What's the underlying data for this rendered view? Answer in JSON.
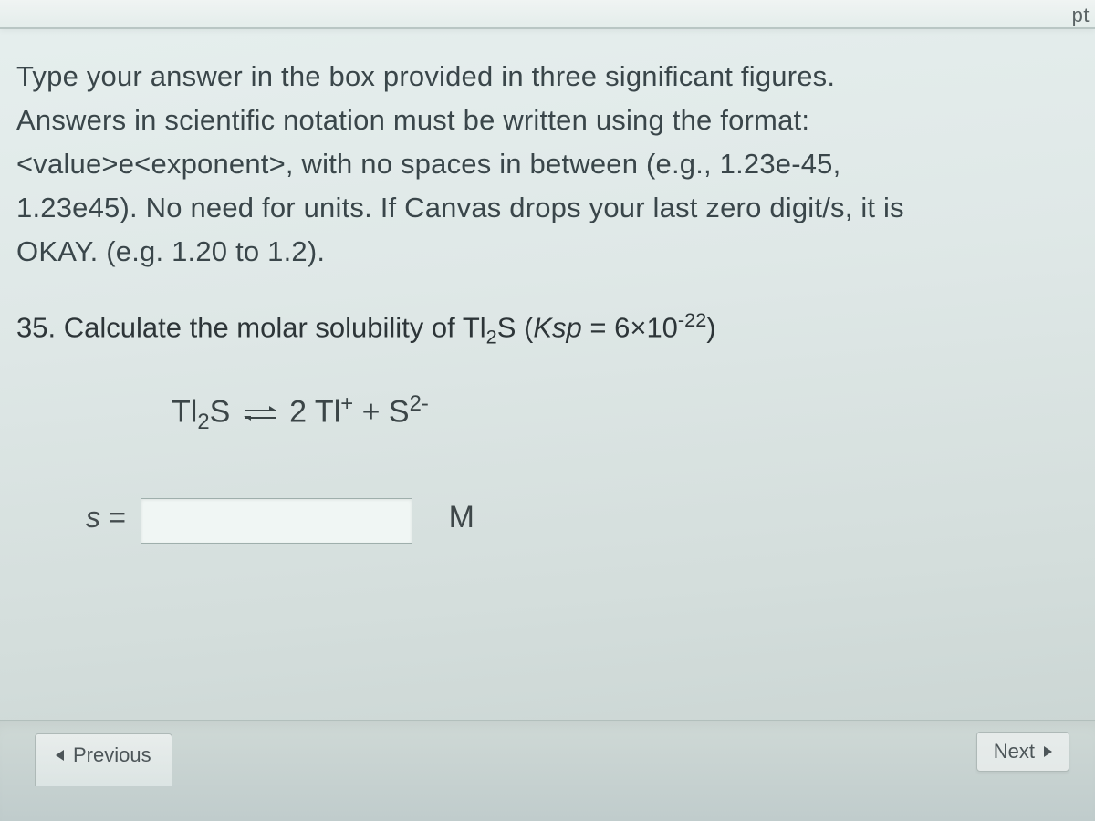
{
  "header": {
    "points_fragment": "pt"
  },
  "instructions": {
    "line1": "Type your answer in the box provided in three significant figures.",
    "line2": "Answers in scientific notation must be written using the format:",
    "line3a": "<value>e<exponent>, with no spaces in between (e.g., 1.23e-45,",
    "line3b": "1.23e45). No need for units.  If Canvas drops your last zero digit/s, it is",
    "line3c": "OKAY. (e.g. 1.20 to 1.2)."
  },
  "question": {
    "number": "35.",
    "prompt_pre": "Calculate the molar solubility of Tl",
    "prompt_sub1": "2",
    "prompt_mid": "S (",
    "ksp_label": "Ksp",
    "eq": " = 6×10",
    "exp": "-22",
    "close": ")"
  },
  "equation": {
    "lhs_a": "Tl",
    "lhs_sub": "2",
    "lhs_b": "S",
    "rhs_coef": "2",
    "rhs_a": " Tl",
    "rhs_a_sup": "+",
    "plus": " + ",
    "rhs_b": "S",
    "rhs_b_sup": "2-"
  },
  "answer": {
    "label": "s =",
    "value": "",
    "unit": "M"
  },
  "nav": {
    "previous": "Previous",
    "next": "Next"
  }
}
